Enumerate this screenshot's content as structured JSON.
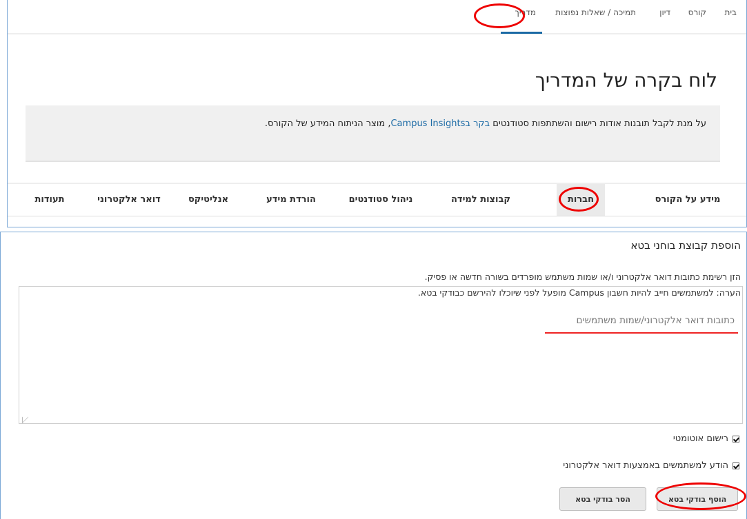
{
  "topnav": {
    "items": [
      "בית",
      "קורס",
      "דיון",
      "תמיכה / שאלות נפוצות",
      "מדריך"
    ]
  },
  "page_title": "לוח בקרה של המדריך",
  "banner": {
    "text_before": "על מנת לקבל תובנות אודות רישום והשתתפות סטודנטים",
    "link_text": "בקר בCampus Insights",
    "text_after": ", מוצר הניתוח המידע של הקורס."
  },
  "tabs": [
    "מידע על הקורס",
    "חברות",
    "קבוצות למידה",
    "ניהול סטודנטים",
    "הורדת מידע",
    "אנליטיקס",
    "דואר אלקטרוני",
    "תעודות"
  ],
  "beta": {
    "title": "הוספת קבוצת בוחני בטא",
    "instruction1": "הזן רשימת כתובות דואר אלקטרוני ו/או שמות משתמש מופרדים בשורה חדשה או פסיק.",
    "instruction2": "הערה: למשתמשים חייב להיות חשבון Campus מופעל לפני שיוכלו להירשם כבודקי בטא.",
    "placeholder": "כתובות דואר אלקטרוני/שמות משתמשים",
    "auto_enroll": "רישום אוטומטי",
    "notify": "הודע למשתמשים באמצעות דואר אלקטרוני",
    "add_button": "הוסף בודקי בטא",
    "remove_button": "הסר בודקי בטא"
  },
  "colors": {
    "accent": "#1b6aa5",
    "annotation": "#e00000"
  }
}
